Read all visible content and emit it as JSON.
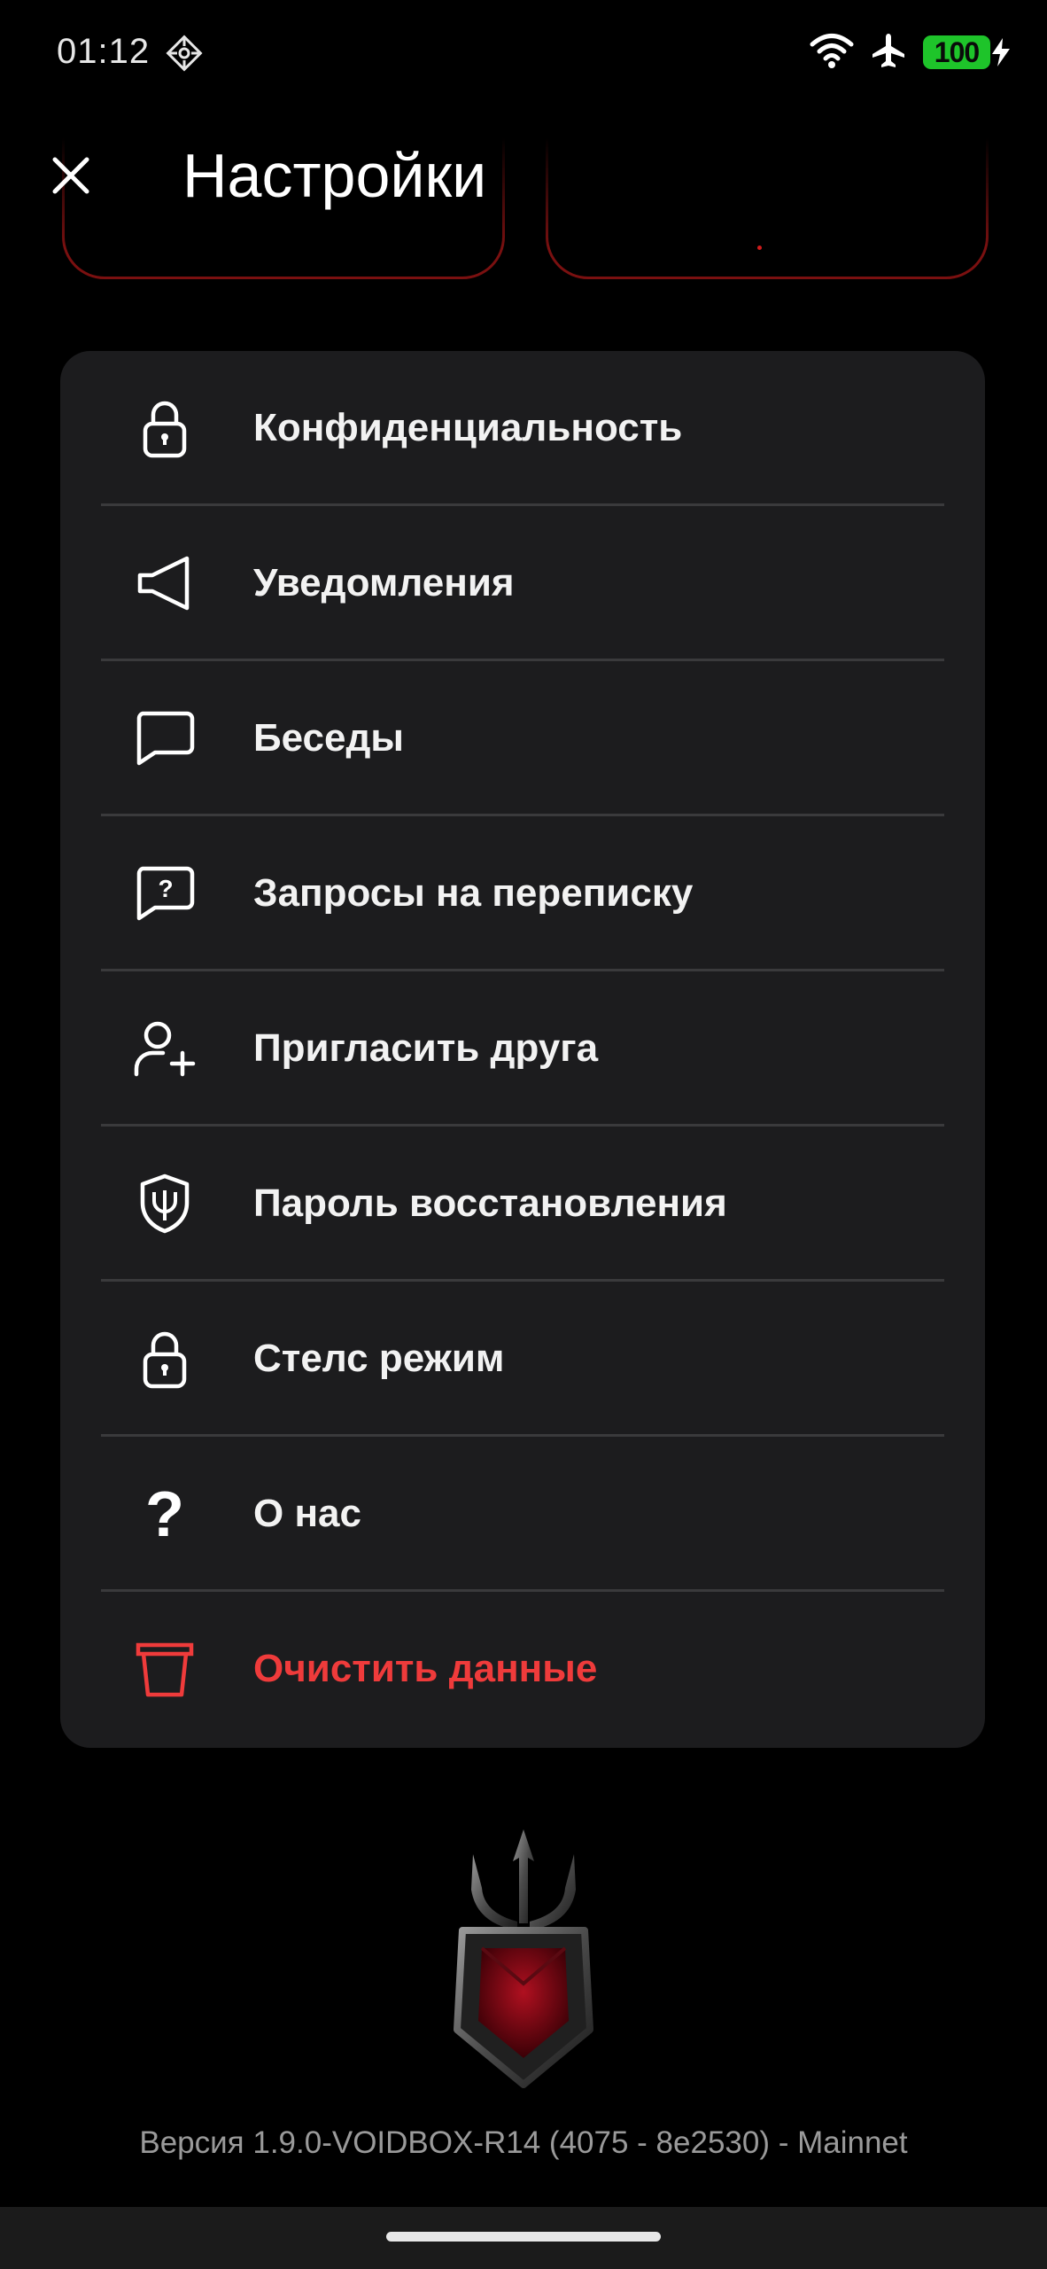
{
  "status_bar": {
    "time": "01:12",
    "battery": "100",
    "icons": [
      "app-badge-icon",
      "wifi-icon",
      "airplane-icon",
      "battery-icon",
      "charging-bolt-icon"
    ],
    "battery_color": "#1ec42a"
  },
  "header": {
    "title": "Настройки",
    "close_icon": "close-icon"
  },
  "settings": {
    "items": [
      {
        "label": "Конфиденциальность",
        "icon": "lock-icon"
      },
      {
        "label": "Уведомления",
        "icon": "speaker-icon"
      },
      {
        "label": "Беседы",
        "icon": "chat-bubble-icon"
      },
      {
        "label": "Запросы на переписку",
        "icon": "chat-question-icon"
      },
      {
        "label": "Пригласить друга",
        "icon": "add-user-icon"
      },
      {
        "label": "Пароль восстановления",
        "icon": "shield-trident-icon"
      },
      {
        "label": "Стелс режим",
        "icon": "lock-icon"
      },
      {
        "label": "О нас",
        "icon": "question-icon"
      },
      {
        "label": "Очистить данные",
        "icon": "trash-icon",
        "danger": true
      }
    ],
    "danger_color": "#ef3b3b",
    "card_color": "#1c1c1e"
  },
  "footer": {
    "logo": "trident-shield-logo",
    "version": "Версия  1.9.0-VOIDBOX-R14 (4075 - 8e2530)  - Mainnet"
  }
}
